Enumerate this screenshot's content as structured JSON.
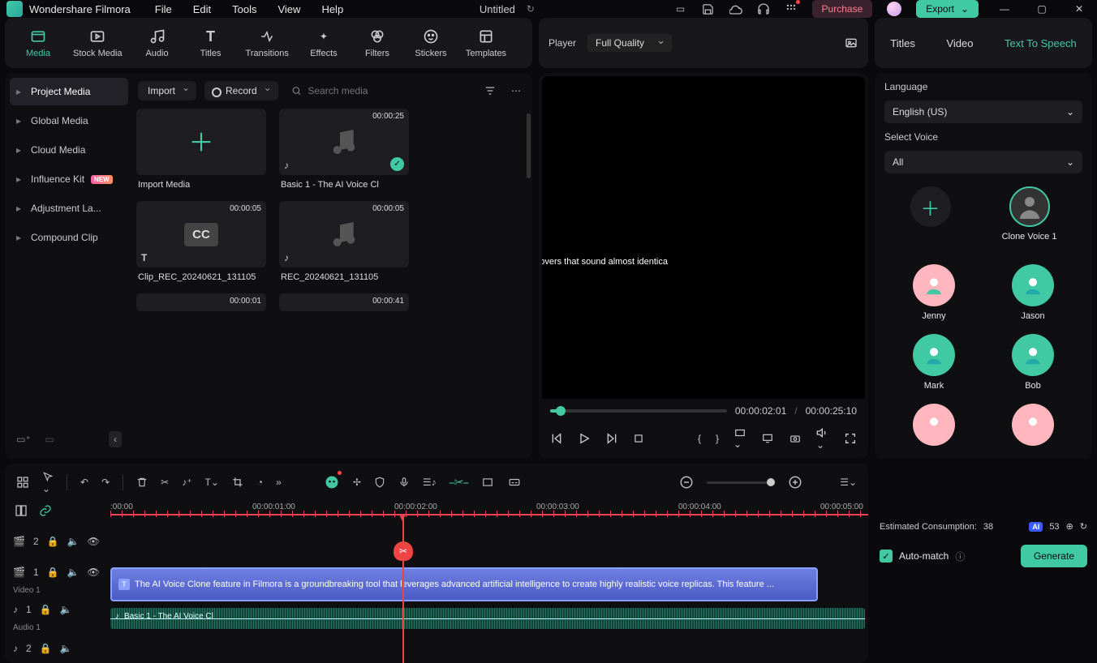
{
  "app_name": "Wondershare Filmora",
  "menus": [
    "File",
    "Edit",
    "Tools",
    "View",
    "Help"
  ],
  "doc_title": "Untitled",
  "purchase_label": "Purchase",
  "export_label": "Export",
  "asset_tabs": [
    "Media",
    "Stock Media",
    "Audio",
    "Titles",
    "Transitions",
    "Effects",
    "Filters",
    "Stickers",
    "Templates"
  ],
  "player": {
    "label": "Player",
    "quality": "Full Quality",
    "subtitle": "eplicas. This feature enables users to generate voiceovers that sound almost identica",
    "current": "00:00:02:01",
    "total": "00:00:25:10"
  },
  "right_tabs": [
    "Titles",
    "Video",
    "Text To Speech"
  ],
  "sidebar": {
    "items": [
      "Project Media",
      "Global Media",
      "Cloud Media",
      "Influence Kit",
      "Adjustment La...",
      "Compound Clip"
    ]
  },
  "grid_toolbar": {
    "import": "Import",
    "record": "Record",
    "search_placeholder": "Search media"
  },
  "cards": [
    {
      "title": "Import Media"
    },
    {
      "title": "Basic 1 - The AI Voice Cl",
      "dur": "00:00:25",
      "ok": true,
      "audio": true
    },
    {
      "title": "Clip_REC_20240621_131105",
      "dur": "00:00:05",
      "cc": true,
      "text": true
    },
    {
      "title": "REC_20240621_131105",
      "dur": "00:00:05",
      "audio": true
    },
    {
      "title": "",
      "dur": "00:00:01"
    },
    {
      "title": "",
      "dur": "00:00:41"
    }
  ],
  "tts": {
    "language_label": "Language",
    "language": "English (US)",
    "select_label": "Select Voice",
    "filter": "All",
    "selected_voice": "Clone Voice 1",
    "avatars": [
      "Jenny",
      "Jason",
      "Mark",
      "Bob"
    ],
    "consumption_label": "Estimated Consumption:",
    "consumption": "38",
    "credits": "53",
    "automatch": "Auto-match",
    "generate": "Generate"
  },
  "timeline": {
    "ticks": [
      ":00:00",
      "00:00:01:00",
      "00:00:02:00",
      "00:00:03:00",
      "00:00:04:00",
      "00:00:05:00"
    ],
    "tracks": {
      "t2": "2",
      "v1": "1",
      "v1l": "Video 1",
      "a1": "1",
      "a1l": "Audio 1",
      "a2": "2"
    },
    "text_clip": "The AI Voice Clone feature in Filmora is a groundbreaking tool that leverages advanced artificial intelligence to create highly realistic voice replicas. This feature ...",
    "audio_clip": "Basic 1 - The AI Voice Cl"
  }
}
